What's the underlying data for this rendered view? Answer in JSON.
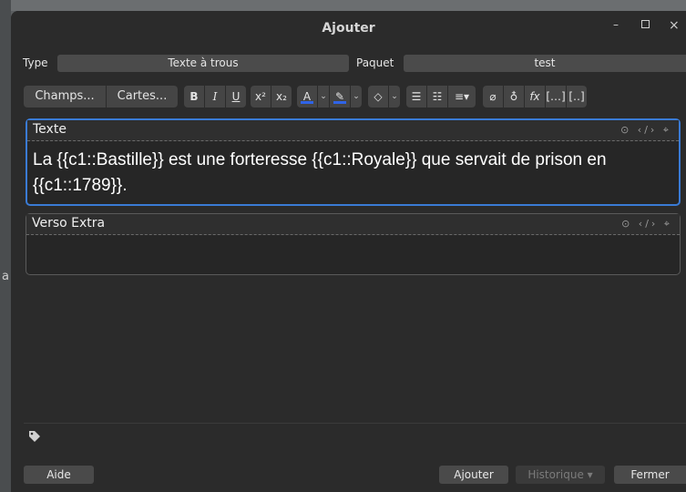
{
  "window": {
    "title": "Ajouter"
  },
  "note_type": {
    "label": "Type",
    "value": "Texte à trous"
  },
  "deck": {
    "label": "Paquet",
    "value": "test"
  },
  "toolbar": {
    "fields_label": "Champs...",
    "cards_label": "Cartes..."
  },
  "fields": [
    {
      "name": "Texte",
      "content": "La {{c1::Bastille}} est une forteresse {{c1::Royale}} que servait de prison en {{c1::1789}}."
    },
    {
      "name": "Verso Extra",
      "content": ""
    }
  ],
  "buttons": {
    "help": "Aide",
    "add": "Ajouter",
    "history": "Historique ▾",
    "close": "Fermer"
  },
  "colors": {
    "accent": "#3a7bd5",
    "text_color_bar": "#2f64e8"
  }
}
